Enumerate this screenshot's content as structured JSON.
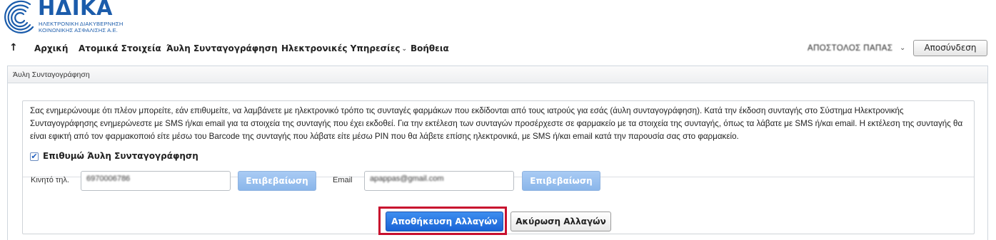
{
  "brand": {
    "name": "ΗΔΙΚΑ",
    "subtitle_line1": "ΗΛΕΚΤΡΟΝΙΚΗ ΔΙΑΚΥΒΕΡΝΗΣΗ",
    "subtitle_line2": "ΚΟΙΝΩΝΙΚΗΣ ΑΣΦΑΛΙΣΗΣ Α.Ε.",
    "color": "#1b5cab"
  },
  "nav": {
    "up_icon": "↑",
    "items": [
      {
        "label": "Αρχική"
      },
      {
        "label": "Ατομικά Στοιχεία"
      },
      {
        "label": "Άυλη Συνταγογράφηση"
      },
      {
        "label": "Ηλεκτρονικές Υπηρεσίες"
      },
      {
        "label": "Βοήθεια"
      }
    ],
    "user_name": "ΑΠΟΣΤΟΛΟΣ ΠΑΠΑΣ",
    "logout_label": "Αποσύνδεση"
  },
  "panel": {
    "title": "Άυλη Συνταγογράφηση",
    "info_text": "Σας ενημερώνουμε ότι πλέον μπορείτε, εάν επιθυμείτε, να λαμβάνετε με ηλεκτρονικό τρόπο τις συνταγές φαρμάκων που εκδίδονται από τους ιατρούς για εσάς (άυλη συνταγογράφηση). Κατά την έκδοση συνταγής στο Σύστημα Ηλεκτρονικής Συνταγογράφησης ενημερώνεστε με SMS ή/και email για τα στοιχεία της συνταγής που έχει εκδοθεί. Για την εκτέλεση των συνταγών προσέρχεστε σε φαρμακείο με τα στοιχεία της συνταγής, όπως τα λάβατε με SMS ή/και email. Η εκτέλεση της συνταγής θα είναι εφικτή από τον φαρμακοποιό είτε μέσω του Barcode της συνταγής που λάβατε είτε μέσω PIN που θα λάβετε επίσης ηλεκτρονικά, με SMS ή/και email κατά την παρουσία σας στο φαρμακείο.",
    "checkbox": {
      "label": "Επιθυμώ Άυλη Συνταγογράφηση",
      "checked": true
    },
    "mobile": {
      "label": "Κινητό τηλ.",
      "value": "6970006786",
      "confirm_label": "Επιβεβαίωση"
    },
    "email": {
      "label": "Email",
      "value": "apappas@gmail.com",
      "confirm_label": "Επιβεβαίωση"
    }
  },
  "actions": {
    "save_label": "Αποθήκευση Αλλαγών",
    "cancel_label": "Ακύρωση Αλλαγών",
    "highlight_color": "#c8102e"
  }
}
